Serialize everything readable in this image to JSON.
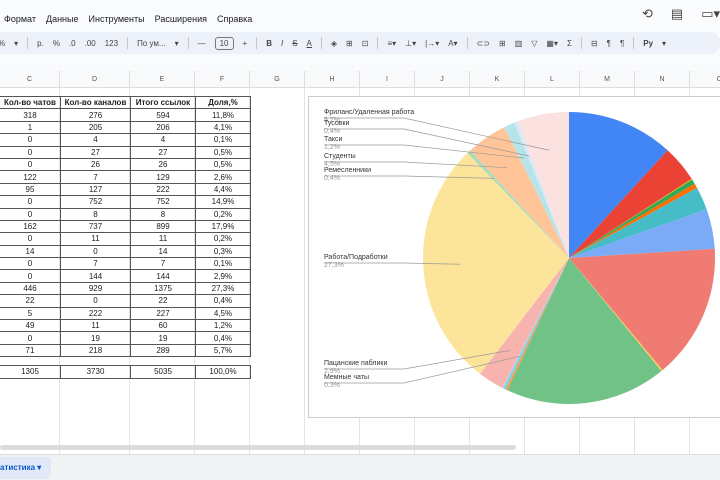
{
  "menu": [
    "Формат",
    "Данные",
    "Инструменты",
    "Расширения",
    "Справка"
  ],
  "toolbar": {
    "percent": "%",
    "currency": "р.",
    "percent_fmt": "%",
    "dec_less": ".0",
    "dec_more": ".00",
    "num_fmt": "123",
    "font": "По ум...",
    "font_size": "10",
    "bold": "B",
    "italic": "I",
    "strike": "S",
    "text_color": "A",
    "sum": "Σ",
    "input_tools": "Py"
  },
  "columns": [
    "C",
    "D",
    "E",
    "F",
    "G",
    "H",
    "I",
    "J",
    "K",
    "L",
    "M",
    "N",
    "O"
  ],
  "table": {
    "headers": [
      "Кол-во чатов",
      "Кол-во каналов",
      "Итого ссылок",
      "Доля,%"
    ],
    "rows": [
      [
        "318",
        "276",
        "594",
        "11,8%"
      ],
      [
        "1",
        "205",
        "206",
        "4,1%"
      ],
      [
        "0",
        "4",
        "4",
        "0,1%"
      ],
      [
        "0",
        "27",
        "27",
        "0,5%"
      ],
      [
        "0",
        "26",
        "26",
        "0,5%"
      ],
      [
        "122",
        "7",
        "129",
        "2,6%"
      ],
      [
        "95",
        "127",
        "222",
        "4,4%"
      ],
      [
        "0",
        "752",
        "752",
        "14,9%"
      ],
      [
        "0",
        "8",
        "8",
        "0,2%"
      ],
      [
        "162",
        "737",
        "899",
        "17,9%"
      ],
      [
        "0",
        "11",
        "11",
        "0,2%"
      ],
      [
        "14",
        "0",
        "14",
        "0,3%"
      ],
      [
        "0",
        "7",
        "7",
        "0,1%"
      ],
      [
        "0",
        "144",
        "144",
        "2,9%"
      ],
      [
        "446",
        "929",
        "1375",
        "27,3%"
      ],
      [
        "22",
        "0",
        "22",
        "0,4%"
      ],
      [
        "5",
        "222",
        "227",
        "4,5%"
      ],
      [
        "49",
        "11",
        "60",
        "1,2%"
      ],
      [
        "0",
        "19",
        "19",
        "0,4%"
      ],
      [
        "71",
        "218",
        "289",
        "5,7%"
      ]
    ],
    "total": [
      "1305",
      "3730",
      "5035",
      "100,0%"
    ]
  },
  "chart_data": {
    "type": "pie",
    "values": [
      594,
      206,
      4,
      27,
      26,
      129,
      222,
      752,
      8,
      899,
      11,
      14,
      7,
      144,
      1375,
      22,
      227,
      60,
      19,
      289
    ],
    "colors": [
      "#4285f4",
      "#ea4335",
      "#fbbc04",
      "#34a853",
      "#ff6d01",
      "#46bdc6",
      "#7baaf7",
      "#f07b72",
      "#fcd04f",
      "#71c287",
      "#ff994d",
      "#7ed1d7",
      "#b3cefb",
      "#f7b4ae",
      "#fde49b",
      "#aedcba",
      "#ffc599",
      "#b5e5e8",
      "#d9e7fd",
      "#fbe1df"
    ],
    "labels": [
      {
        "index": 19,
        "name": "Фриланс/Удаленная работа",
        "pct": "5,7%"
      },
      {
        "index": 18,
        "name": "Тусовки",
        "pct": "0,4%"
      },
      {
        "index": 17,
        "name": "Такси",
        "pct": "1,2%"
      },
      {
        "index": 16,
        "name": "Студенты",
        "pct": "4,5%"
      },
      {
        "index": 15,
        "name": "Ремесленники",
        "pct": "0,4%"
      },
      {
        "index": 14,
        "name": "Работа/Подработки",
        "pct": "27,3%"
      },
      {
        "index": 13,
        "name": "Пацанские паблики",
        "pct": "2,9%"
      },
      {
        "index": 11,
        "name": "Мемные чаты",
        "pct": "0,3%"
      }
    ]
  },
  "sheet_tab": "атистика"
}
